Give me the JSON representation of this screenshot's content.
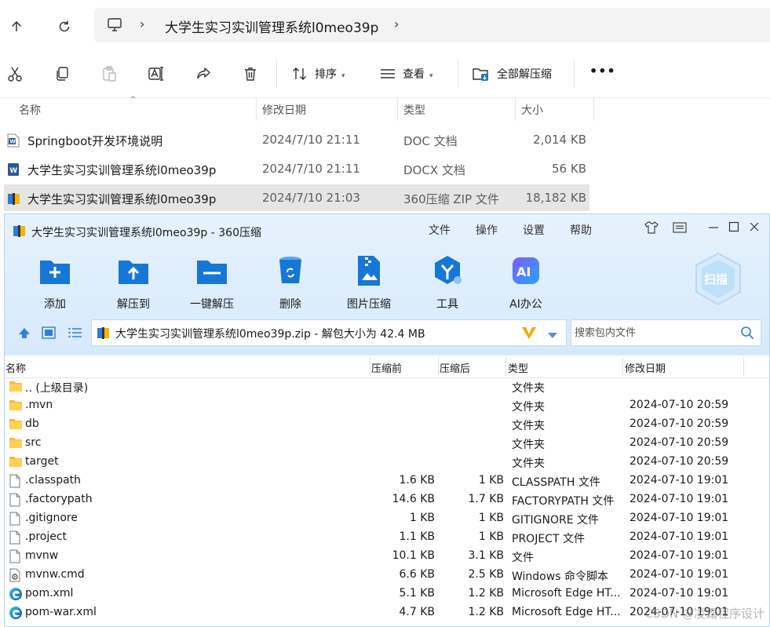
{
  "explorer": {
    "breadcrumb": "大学生实习实训管理系统l0meo39p",
    "toolbar": {
      "sort_label": "排序",
      "view_label": "查看",
      "extract_all_label": "全部解压缩",
      "more_label": "•••"
    },
    "columns": {
      "name": "名称",
      "modified": "修改日期",
      "type": "类型",
      "size": "大小"
    },
    "files": [
      {
        "name": "Springboot开发环境说明",
        "modified": "2024/7/10 21:11",
        "type": "DOC 文档",
        "size": "2,014 KB",
        "icon": "word-doc-icon"
      },
      {
        "name": "大学生实习实训管理系统l0meo39p",
        "modified": "2024/7/10 21:11",
        "type": "DOCX 文档",
        "size": "56 KB",
        "icon": "word-docx-icon"
      },
      {
        "name": "大学生实习实训管理系统l0meo39p",
        "modified": "2024/7/10 21:03",
        "type": "360压缩 ZIP 文件",
        "size": "18,182 KB",
        "icon": "zip-archive-icon"
      }
    ]
  },
  "zip": {
    "title": "大学生实习实训管理系统l0meo39p - 360压缩",
    "menu": [
      "文件",
      "操作",
      "设置",
      "帮助"
    ],
    "tools": [
      "添加",
      "解压到",
      "一键解压",
      "删除",
      "图片压缩",
      "工具",
      "AI办公"
    ],
    "scan_label": "扫描",
    "path_text": "大学生实习实训管理系统l0meo39p.zip - 解包大小为 42.4 MB",
    "search_placeholder": "搜索包内文件",
    "columns": {
      "name": "名称",
      "before": "压缩前",
      "after": "压缩后",
      "type": "类型",
      "modified": "修改日期"
    },
    "rows": [
      {
        "name": ".. (上级目录)",
        "before": "",
        "after": "",
        "type": "文件夹",
        "modified": "",
        "icon": "folder"
      },
      {
        "name": ".mvn",
        "before": "",
        "after": "",
        "type": "文件夹",
        "modified": "2024-07-10 20:59",
        "icon": "folder"
      },
      {
        "name": "db",
        "before": "",
        "after": "",
        "type": "文件夹",
        "modified": "2024-07-10 20:59",
        "icon": "folder"
      },
      {
        "name": "src",
        "before": "",
        "after": "",
        "type": "文件夹",
        "modified": "2024-07-10 20:59",
        "icon": "folder"
      },
      {
        "name": "target",
        "before": "",
        "after": "",
        "type": "文件夹",
        "modified": "2024-07-10 20:59",
        "icon": "folder"
      },
      {
        "name": ".classpath",
        "before": "1.6 KB",
        "after": "1 KB",
        "type": "CLASSPATH 文件",
        "modified": "2024-07-10 19:01",
        "icon": "file"
      },
      {
        "name": ".factorypath",
        "before": "14.6 KB",
        "after": "1.7 KB",
        "type": "FACTORYPATH 文件",
        "modified": "2024-07-10 19:01",
        "icon": "file"
      },
      {
        "name": ".gitignore",
        "before": "1 KB",
        "after": "1 KB",
        "type": "GITIGNORE 文件",
        "modified": "2024-07-10 19:01",
        "icon": "file"
      },
      {
        "name": ".project",
        "before": "1.1 KB",
        "after": "1 KB",
        "type": "PROJECT 文件",
        "modified": "2024-07-10 19:01",
        "icon": "file"
      },
      {
        "name": "mvnw",
        "before": "10.1 KB",
        "after": "3.1 KB",
        "type": "文件",
        "modified": "2024-07-10 19:01",
        "icon": "file"
      },
      {
        "name": "mvnw.cmd",
        "before": "6.6 KB",
        "after": "2.5 KB",
        "type": "Windows 命令脚本",
        "modified": "2024-07-10 19:01",
        "icon": "cmd"
      },
      {
        "name": "pom.xml",
        "before": "5.1 KB",
        "after": "1.2 KB",
        "type": "Microsoft Edge HT...",
        "modified": "2024-07-10 19:01",
        "icon": "edge"
      },
      {
        "name": "pom-war.xml",
        "before": "4.7 KB",
        "after": "1.2 KB",
        "type": "Microsoft Edge HT...",
        "modified": "2024-07-10 19:01",
        "icon": "edge"
      }
    ],
    "watermark": "CSDN @凌霜程序设计"
  }
}
